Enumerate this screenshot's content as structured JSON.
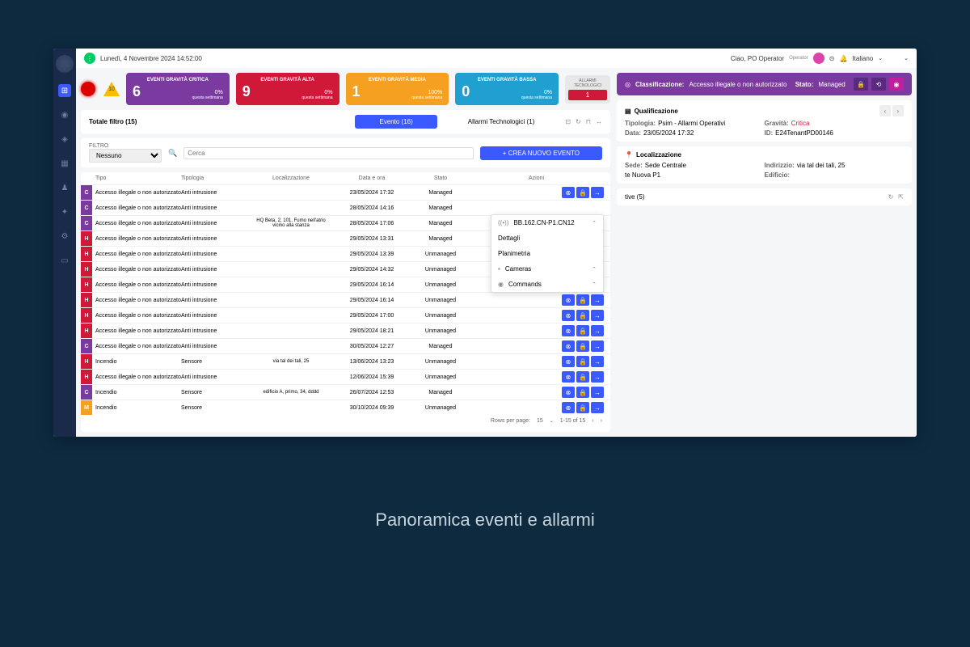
{
  "caption": "Panoramica eventi e allarmi",
  "topbar": {
    "datetime": "Lunedì, 4 Novembre 2024 14:52:00",
    "greeting": "Ciao, PO Operator",
    "role": "Operator",
    "lang": "Italiano"
  },
  "alarm_triangle": "10",
  "cards": [
    {
      "title": "EVENTI GRAVITÀ CRITICA",
      "num": "6",
      "pct": "0%",
      "sub": "questa settimana",
      "cls": "c-purple"
    },
    {
      "title": "EVENTI GRAVITÀ ALTA",
      "num": "9",
      "pct": "0%",
      "sub": "questa settimana",
      "cls": "c-red"
    },
    {
      "title": "EVENTI GRAVITÀ MEDIA",
      "num": "1",
      "pct": "100%",
      "sub": "questa settimana",
      "cls": "c-orange"
    },
    {
      "title": "EVENTI GRAVITÀ BASSA",
      "num": "0",
      "pct": "0%",
      "sub": "questa settimana",
      "cls": "c-blue"
    }
  ],
  "tech_card": {
    "title": "ALLARMI TECNOLOGICI",
    "num": "1"
  },
  "bar": {
    "total": "Totale filtro (15)",
    "tab1": "Evento (16)",
    "tab2": "Allarmi Technologici (1)"
  },
  "filter": {
    "label": "FILTRO",
    "value": "Nessuno",
    "search_ph": "Cerca",
    "btn": "+  CREA NUOVO EVENTO"
  },
  "columns": {
    "tipo": "Tipo",
    "tipologia": "Tipologia",
    "loc": "Localizzazione",
    "data": "Data e ora",
    "stato": "Stato",
    "azioni": "Azioni"
  },
  "rows": [
    {
      "sev": "C",
      "tipo": "Accesso illegale o non autorizzato",
      "tipol": "Anti intrusione",
      "loc": "",
      "data": "23/05/2024 17:32",
      "stato": "Managed",
      "az": true
    },
    {
      "sev": "C",
      "tipo": "Accesso illegale o non autorizzato",
      "tipol": "Anti intrusione",
      "loc": "",
      "data": "28/05/2024 14:16",
      "stato": "Managed",
      "az": false
    },
    {
      "sev": "C",
      "tipo": "Accesso illegale o non autorizzato",
      "tipol": "Anti intrusione",
      "loc": "HQ Beta, 2, 101, Fumo nell'atrio vicino alla stanza",
      "data": "28/05/2024 17:06",
      "stato": "Managed",
      "az": false
    },
    {
      "sev": "H",
      "tipo": "Accesso illegale o non autorizzato",
      "tipol": "Anti intrusione",
      "loc": "",
      "data": "29/05/2024 13:31",
      "stato": "Managed",
      "az": false
    },
    {
      "sev": "H",
      "tipo": "Accesso illegale o non autorizzato",
      "tipol": "Anti intrusione",
      "loc": "",
      "data": "29/05/2024 13:39",
      "stato": "Unmanaged",
      "az": false
    },
    {
      "sev": "H",
      "tipo": "Accesso illegale o non autorizzato",
      "tipol": "Anti intrusione",
      "loc": "",
      "data": "29/05/2024 14:32",
      "stato": "Unmanaged",
      "az": false
    },
    {
      "sev": "H",
      "tipo": "Accesso illegale o non autorizzato",
      "tipol": "Anti intrusione",
      "loc": "",
      "data": "29/05/2024 16:14",
      "stato": "Unmanaged",
      "az": true
    },
    {
      "sev": "H",
      "tipo": "Accesso illegale o non autorizzato",
      "tipol": "Anti intrusione",
      "loc": "",
      "data": "29/05/2024 16:14",
      "stato": "Unmanaged",
      "az": true
    },
    {
      "sev": "H",
      "tipo": "Accesso illegale o non autorizzato",
      "tipol": "Anti intrusione",
      "loc": "",
      "data": "29/05/2024 17:00",
      "stato": "Unmanaged",
      "az": true
    },
    {
      "sev": "H",
      "tipo": "Accesso illegale o non autorizzato",
      "tipol": "Anti intrusione",
      "loc": "",
      "data": "29/05/2024 18:21",
      "stato": "Unmanaged",
      "az": true
    },
    {
      "sev": "C",
      "tipo": "Accesso illegale o non autorizzato",
      "tipol": "Anti intrusione",
      "loc": "",
      "data": "30/05/2024 12:27",
      "stato": "Managed",
      "az": true
    },
    {
      "sev": "H",
      "tipo": "Incendio",
      "tipol": "Sensore",
      "loc": "via tal dei tali, 25",
      "data": "13/06/2024 13:23",
      "stato": "Unmanaged",
      "az": true
    },
    {
      "sev": "H",
      "tipo": "Accesso illegale o non autorizzato",
      "tipol": "Anti intrusione",
      "loc": "",
      "data": "12/06/2024 15:39",
      "stato": "Unmanaged",
      "az": true
    },
    {
      "sev": "C",
      "tipo": "Incendio",
      "tipol": "Sensore",
      "loc": "edificio A, primo, 34, dddd",
      "data": "26/07/2024 12:53",
      "stato": "Managed",
      "az": true
    },
    {
      "sev": "M",
      "tipo": "Incendio",
      "tipol": "Sensore",
      "loc": "",
      "data": "30/10/2024 09:39",
      "stato": "Unmanaged",
      "az": true
    }
  ],
  "pager": {
    "rpp_lbl": "Rows per page:",
    "rpp": "15",
    "range": "1-15 of 15"
  },
  "popup": {
    "device": "BB.162.CN-P1.CN12",
    "i1": "Dettagli",
    "i2": "Planimetria",
    "i3": "Cameras",
    "i4": "Commands"
  },
  "detail": {
    "hdr": {
      "class_lbl": "Classificazione:",
      "class_val": "Accesso illegale o non autorizzato",
      "state_lbl": "Stato:",
      "state_val": "Managed"
    },
    "qual": {
      "title": "Qualificazione",
      "tip_lbl": "Tipologia:",
      "tip_val": "Psim - Allarmi Operativi",
      "grav_lbl": "Gravità:",
      "grav_val": "Critica",
      "data_lbl": "Data:",
      "data_val": "23/05/2024 17:32",
      "id_lbl": "ID:",
      "id_val": "E24TenantPD00146"
    },
    "loc": {
      "title": "Localizzazione",
      "sede_lbl": "Sede:",
      "sede_val": "Sede Centrale",
      "ind_lbl": "Indirizzio:",
      "ind_val": "via tal dei tali, 25",
      "extra": "te Nuova P1",
      "edif_lbl": "Edificio:"
    },
    "ops": {
      "title": "tive (5)"
    }
  }
}
